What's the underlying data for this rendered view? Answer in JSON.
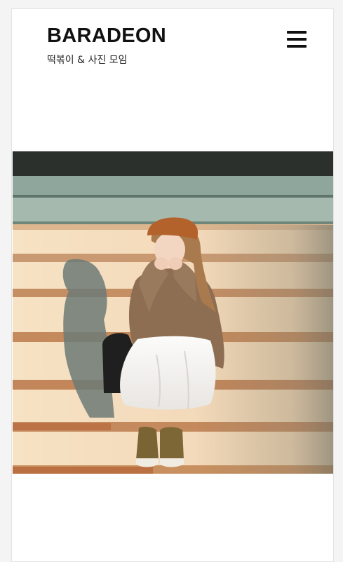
{
  "header": {
    "title": "BARADEON",
    "subtitle": "떡볶이 & 사진 모임",
    "menu_icon": "hamburger-menu-icon"
  },
  "post": {
    "image_alt": "Woman in a beret and sweater sitting on sunlit stairs"
  },
  "colors": {
    "background": "#ffffff",
    "text": "#111111"
  }
}
